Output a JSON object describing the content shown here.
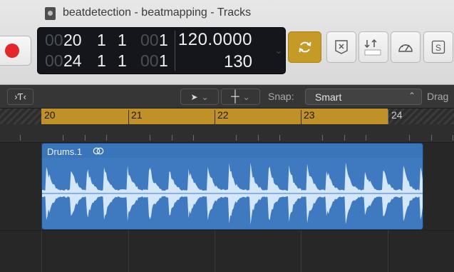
{
  "window": {
    "title": "beatdetection - beatmapping - Tracks"
  },
  "lcd": {
    "position_top": {
      "dim": "00",
      "bar": "20",
      "beat": "1",
      "div": "1",
      "tick_dim": "00",
      "tick": "1"
    },
    "position_bottom": {
      "dim": "00",
      "bar": "24",
      "beat": "1",
      "div": "1",
      "tick_dim": "00",
      "tick": "1"
    },
    "tempo": "120.0000",
    "tempo_secondary": "130"
  },
  "control_bar": {
    "snap_label": "Snap:",
    "snap_value": "Smart",
    "drag_label": "Drag"
  },
  "ruler": {
    "bars": [
      "20",
      "21",
      "22",
      "23",
      "24"
    ]
  },
  "region": {
    "name": "Drums.1"
  },
  "colors": {
    "cycle": "#c59a26",
    "region": "#3f7ac1",
    "waveform": "#d4e6fa",
    "record": "#e5262b"
  },
  "icons": [
    "doc-icon",
    "record-icon",
    "cycle-icon",
    "replace-icon",
    "tuner-icon",
    "metronome-icon",
    "solo-icon",
    "filter-icon",
    "pointer-tool-icon",
    "crosshair-tool-icon",
    "loop-icon"
  ]
}
